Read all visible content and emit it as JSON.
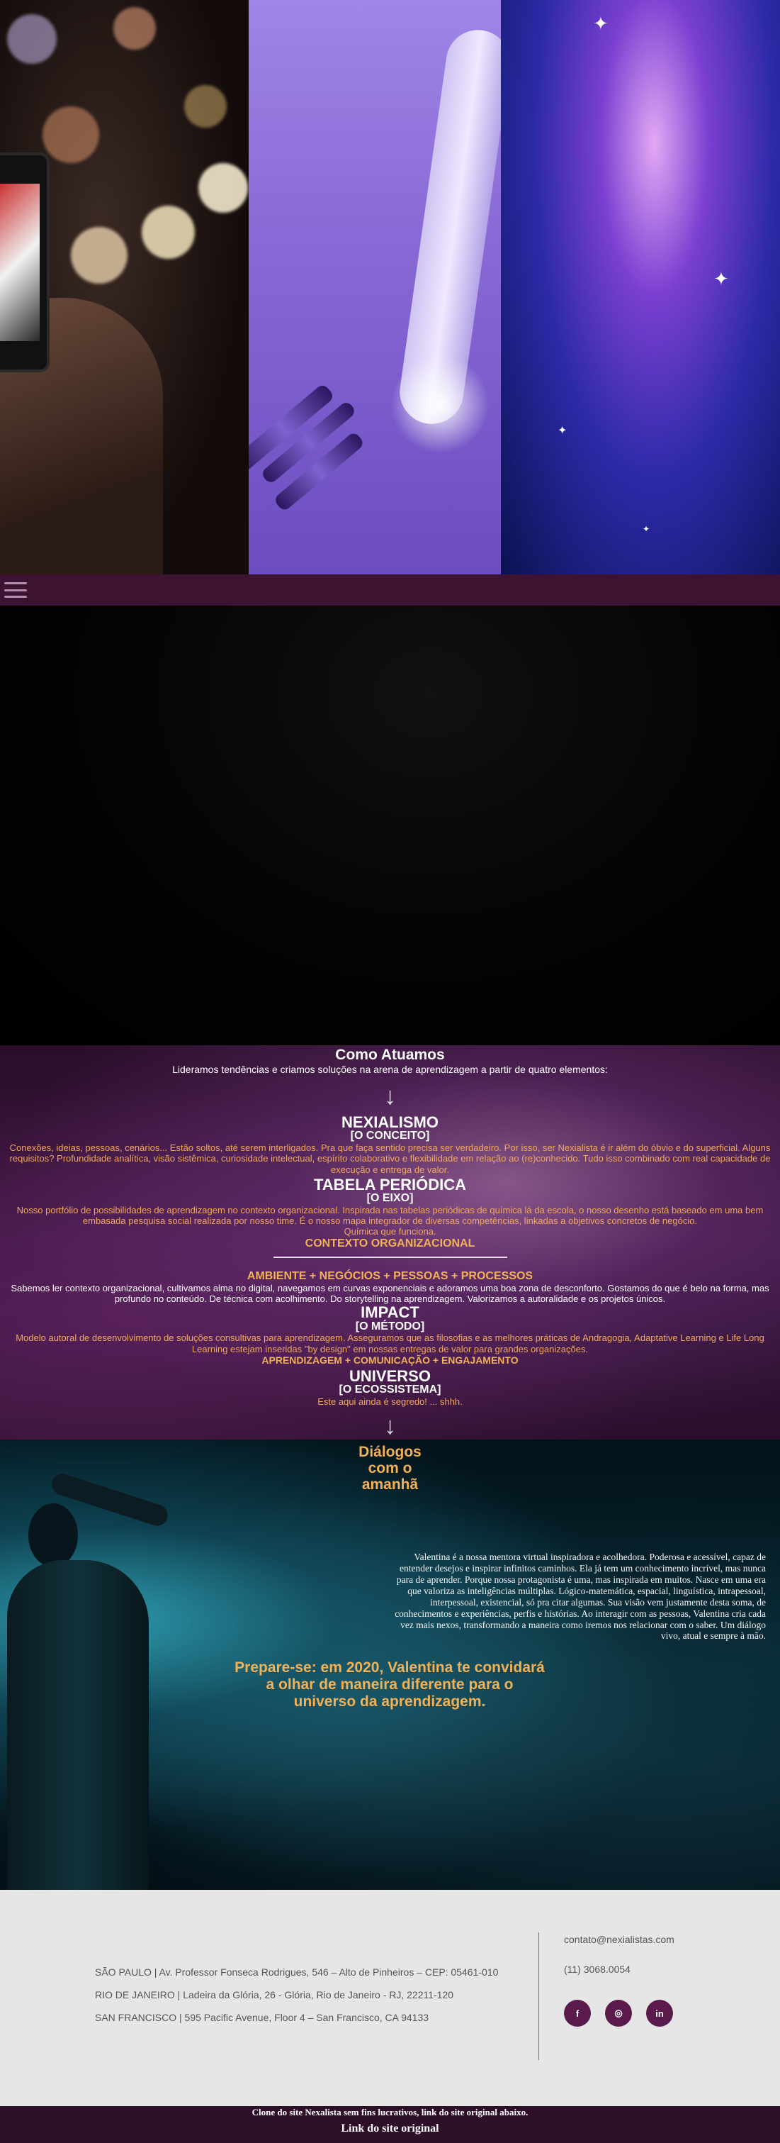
{
  "menu": {
    "icon": "hamburger-menu-icon"
  },
  "como_atuamos": {
    "title": "Como Atuamos",
    "lead": "Lideramos tendências e criamos soluções na arena de aprendizagem a partir de quatro elementos:",
    "arrow": "↓",
    "blocks": [
      {
        "title": "NEXIALISMO",
        "subtitle": "[O CONCEITO]",
        "text": "Conexões, ideias, pessoas, cenários... Estão soltos, até serem interligados. Pra que faça sentido precisa ser verdadeiro. Por isso, ser Nexialista é ir além do óbvio e do superficial. Alguns requisitos? Profundidade analítica, visão sistêmica, curiosidade intelectual, espírito colaborativo e flexibilidade em relação ao (re)conhecido. Tudo isso combinado com real capacidade de execução e entrega de valor."
      },
      {
        "title": "TABELA PERIÓDICA",
        "subtitle": "[O EIXO]",
        "text": "Nosso portfólio de possibilidades de aprendizagem no contexto organizacional. Inspirada nas tabelas periódicas de química lá da escola, o nosso desenho está baseado em uma bem embasada pesquisa social realizada por nosso time. É o nosso mapa integrador de diversas competências, linkadas a objetivos concretos de negócio.",
        "link": "Química que funciona.",
        "heading": "CONTEXTO ORGANIZACIONAL"
      },
      {
        "heading": "AMBIENTE + NEGÓCIOS + PESSOAS + PROCESSOS",
        "text": "Sabemos ler contexto organizacional, cultivamos alma no digital, navegamos em curvas exponenciais e adoramos uma boa zona de desconforto. Gostamos do que é belo na forma, mas profundo no conteúdo. De técnica com acolhimento. Do storytelling na aprendizagem. Valorizamos a autoralidade e os projetos únicos."
      },
      {
        "title": "IMPACT",
        "subtitle": "[O MÉTODO]",
        "text": "Modelo autoral de desenvolvimento de soluções consultivas para aprendizagem. Asseguramos que as filosofias e as melhores práticas de Andragogia, Adaptative Learning e Life Long Learning estejam inseridas \"by design\" em nossas entregas de valor para grandes organizações.",
        "heading": "APRENDIZAGEM + COMUNICAÇÃO + ENGAJAMENTO"
      },
      {
        "title": "UNIVERSO",
        "subtitle": "[O ECOSSISTEMA]",
        "text": "Este aqui ainda é segredo! ... shhh."
      }
    ]
  },
  "dialogos": {
    "title_lines": [
      "Diálogos",
      "com o",
      "amanhã"
    ],
    "text": "Valentina é a nossa mentora virtual inspiradora e acolhedora. Poderosa e acessível, capaz de entender desejos e inspirar infinitos caminhos. Ela já tem um conhecimento incrível, mas nunca para de aprender. Porque nossa protagonista é uma, mas inspirada em muitos. Nasce em uma era que valoriza as inteligências múltiplas. Lógico-matemática, espacial, linguística, intrapessoal, interpessoal, existencial, só pra citar algumas. Sua visão vem justamente desta soma, de conhecimentos e experiências, perfis e histórias. Ao interagir com as pessoas, Valentina cria cada vez mais nexos, transformando a maneira como iremos nos relacionar com o saber. Um diálogo vivo, atual e sempre à mão.",
    "cta_lines": [
      "Prepare-se: em 2020, Valentina te convidará",
      "a olhar de maneira diferente para o",
      "universo da aprendizagem."
    ]
  },
  "footer": {
    "addresses": [
      "SÃO PAULO | Av. Professor Fonseca Rodrigues, 546 – Alto de Pinheiros – CEP: 05461-010",
      "RIO DE JANEIRO | Ladeira da Glória, 26 - Glória, Rio de Janeiro - RJ, 22211-120",
      "SAN FRANCISCO | 595 Pacific Avenue, Floor 4 – San Francisco, CA 94133"
    ],
    "email": "contato@nexialistas.com",
    "phone": "(11) 3068.0054",
    "socials": [
      {
        "icon": "facebook-icon",
        "glyph": "f"
      },
      {
        "icon": "instagram-icon",
        "glyph": "◎"
      },
      {
        "icon": "linkedin-icon",
        "glyph": "in"
      }
    ],
    "accent": "#5a1a4c"
  },
  "strip": {
    "note": "Clone do site Nexalista sem fins lucrativos, link do site original abaixo.",
    "link": "Link do site original"
  },
  "colors": {
    "gold": "#f2b154",
    "orange_text": "#f2a85a",
    "menubar": "#3c1432",
    "strip": "#2e0f2a"
  }
}
